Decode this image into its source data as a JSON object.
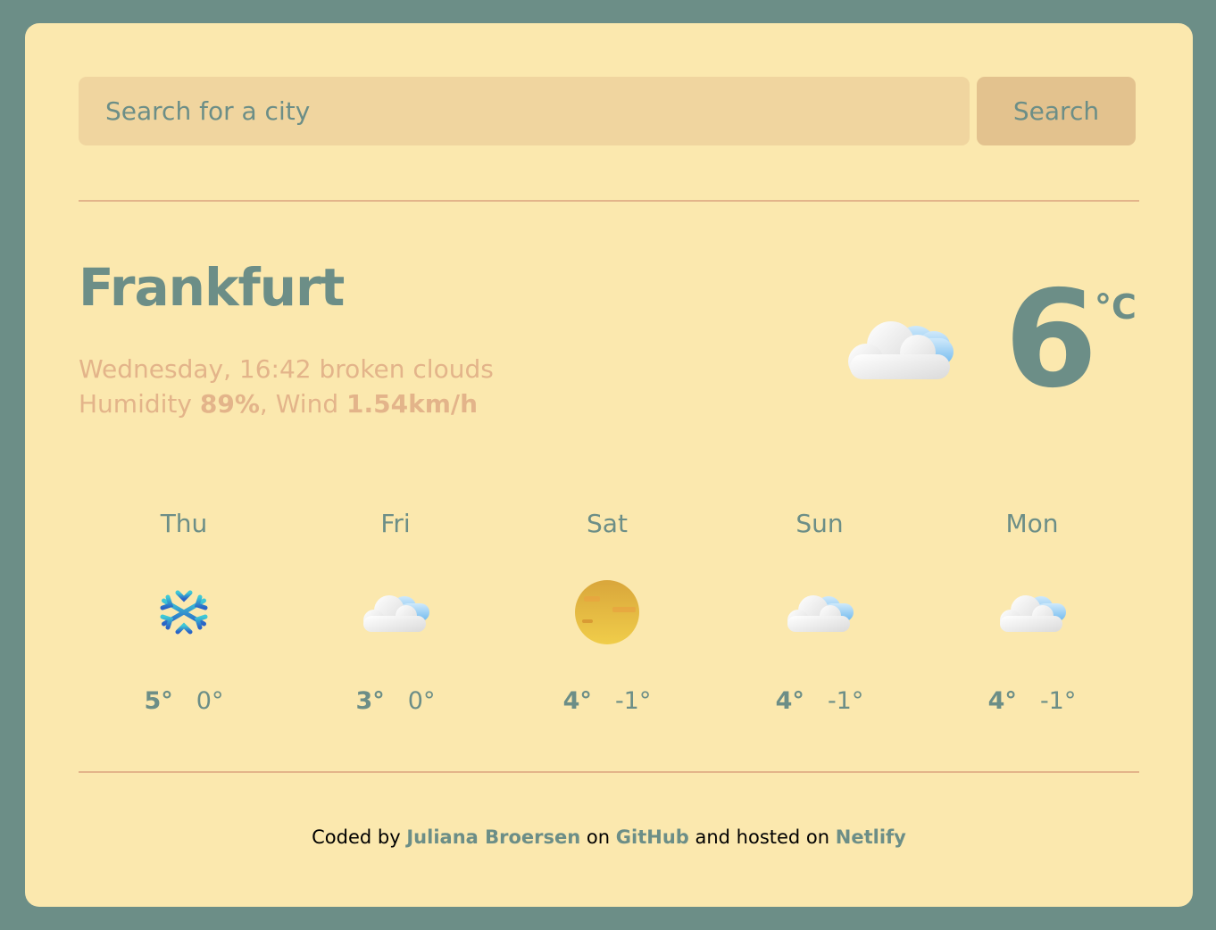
{
  "search": {
    "placeholder": "Search for a city",
    "value": "",
    "button_label": "Search"
  },
  "current": {
    "city": "Frankfurt",
    "datetime": "Wednesday, 16:42",
    "description": "broken clouds",
    "humidity_label": "Humidity",
    "humidity": "89%",
    "wind_label": "Wind",
    "wind": "1.54km/h",
    "temperature": "6",
    "unit": "°C",
    "icon": "broken-clouds-icon"
  },
  "forecast": [
    {
      "day": "Thu",
      "icon": "snow-icon",
      "max": "5°",
      "min": "0°"
    },
    {
      "day": "Fri",
      "icon": "cloud-icon",
      "max": "3°",
      "min": "0°"
    },
    {
      "day": "Sat",
      "icon": "haze-icon",
      "max": "4°",
      "min": "-1°"
    },
    {
      "day": "Sun",
      "icon": "cloud-icon",
      "max": "4°",
      "min": "-1°"
    },
    {
      "day": "Mon",
      "icon": "cloud-icon",
      "max": "4°",
      "min": "-1°"
    }
  ],
  "footer": {
    "prefix": "Coded by",
    "author": "Juliana Broersen",
    "on": "on",
    "repo_link": "GitHub",
    "hosted": "and hosted on",
    "host_link": "Netlify"
  },
  "colors": {
    "background": "#6c8e87",
    "card": "#fbe8ae",
    "accent": "#e3b48a",
    "input": "#f0d59f",
    "button": "#e3c28e"
  }
}
